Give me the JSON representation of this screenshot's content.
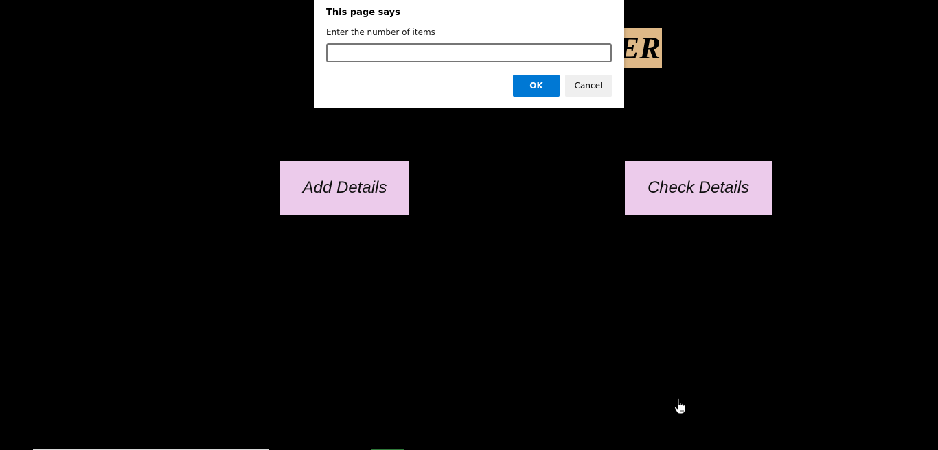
{
  "banner": {
    "text": "ER",
    "color": "#deb887"
  },
  "buttons": {
    "add_details": "Add Details",
    "check_details": "Check Details",
    "color": "#eccbeb"
  },
  "dialog": {
    "title": "This page says",
    "message": "Enter the number of items",
    "input_value": "",
    "ok_label": "OK",
    "cancel_label": "Cancel",
    "ok_color": "#0078d4"
  },
  "cursor": {
    "icon": "hand-pointer-icon"
  }
}
